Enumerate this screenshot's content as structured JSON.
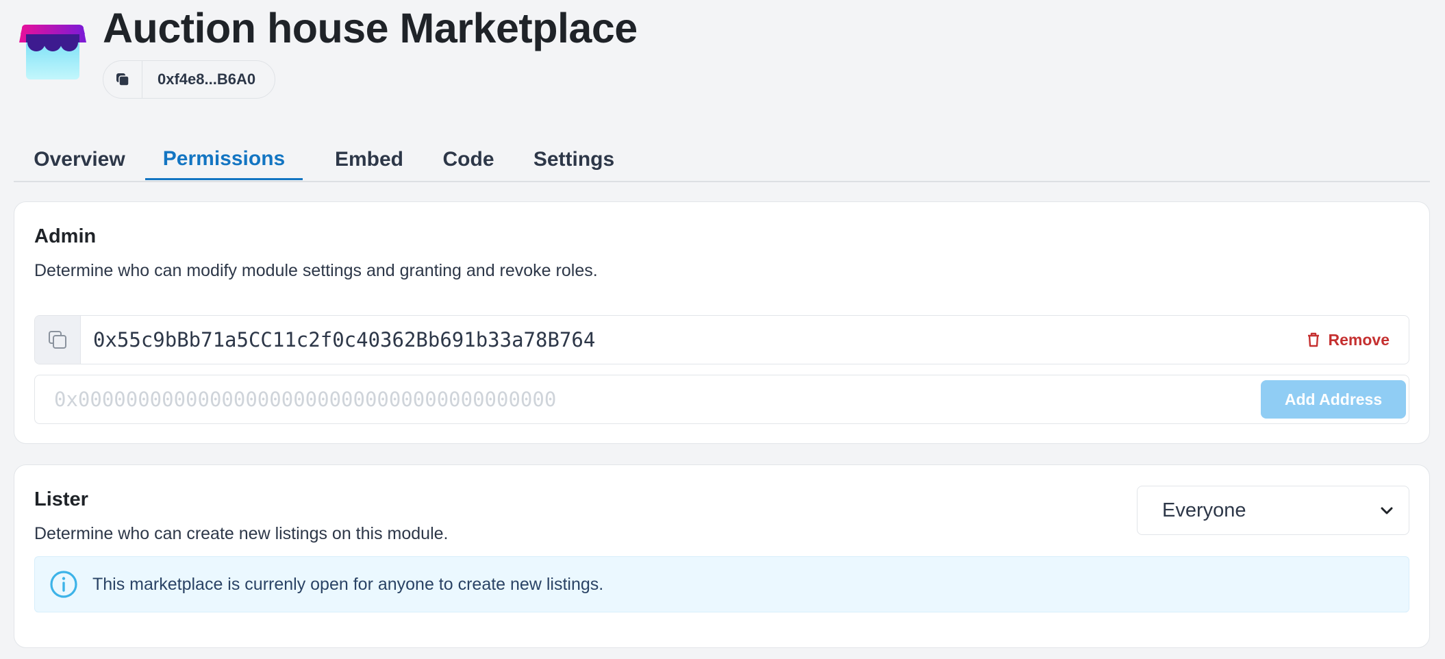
{
  "app": {
    "title": "Auction house Marketplace",
    "contract_address_short": "0xf4e8...B6A0",
    "logo_icon": "storefront-icon"
  },
  "tabs": [
    {
      "label": "Overview",
      "active": false
    },
    {
      "label": "Permissions",
      "active": true
    },
    {
      "label": "Embed",
      "active": false
    },
    {
      "label": "Code",
      "active": false
    },
    {
      "label": "Settings",
      "active": false
    }
  ],
  "admin": {
    "title": "Admin",
    "description": "Determine who can modify module settings and granting and revoke roles.",
    "addresses": [
      "0x55c9bBb71a5CC11c2f0c40362Bb691b33a78B764"
    ],
    "remove_label": "Remove",
    "input_placeholder": "0x0000000000000000000000000000000000000000",
    "add_label": "Add Address"
  },
  "lister": {
    "title": "Lister",
    "description": "Determine who can create new listings on this module.",
    "select_value": "Everyone",
    "info_text": "This marketplace is currenly open for anyone to create new listings."
  },
  "colors": {
    "accent": "#1375c2",
    "danger": "#c53030",
    "button_disabled": "#90cdf4",
    "info_bg": "#ebf8ff",
    "info_icon": "#3db3e8"
  }
}
